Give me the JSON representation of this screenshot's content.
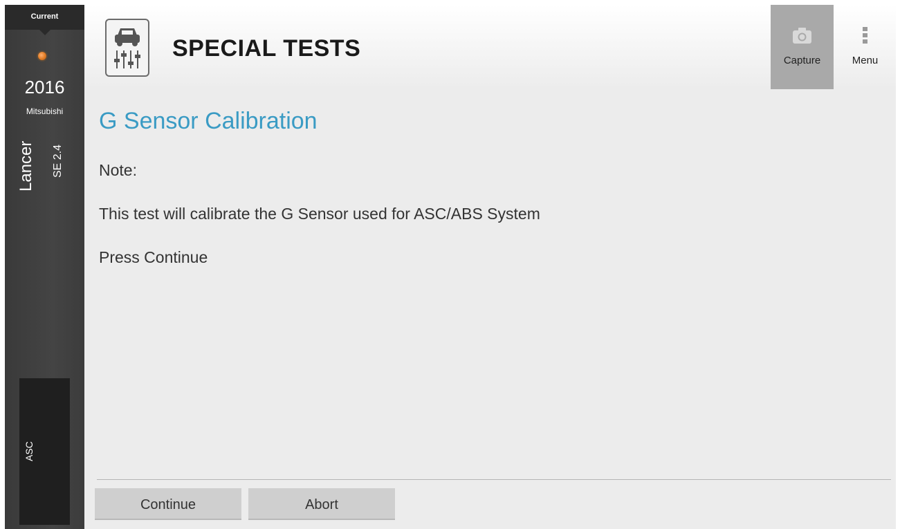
{
  "vehicle": {
    "current_label": "Current",
    "year": "2016",
    "make": "Mitsubishi",
    "model": "Lancer",
    "trim": "SE 2.4",
    "module": "ASC",
    "status_color": "#e07a22"
  },
  "header": {
    "title": "SPECIAL TESTS",
    "icon": "car-tuning-icon",
    "capture_label": "Capture",
    "capture_icon": "camera-icon",
    "menu_label": "Menu",
    "menu_icon": "more-vertical-icon"
  },
  "main": {
    "test_title": "G Sensor Calibration",
    "title_color": "#3a9bc4",
    "lines": [
      "Note:",
      "This test will calibrate the G Sensor used for ASC/ABS System",
      "Press Continue"
    ]
  },
  "actions": {
    "continue_label": "Continue",
    "abort_label": "Abort"
  }
}
